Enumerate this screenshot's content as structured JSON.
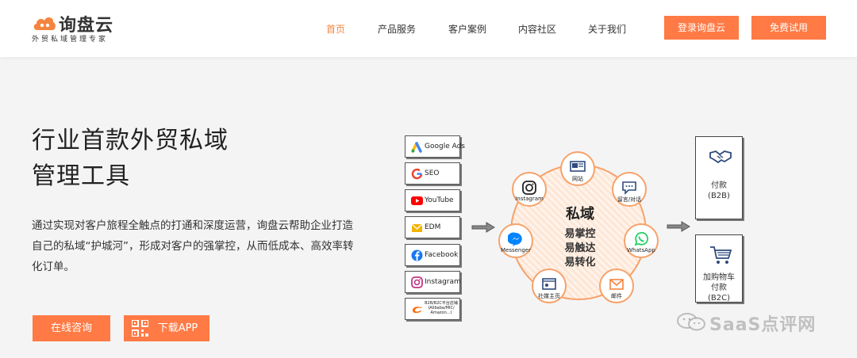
{
  "header": {
    "logo_name": "询盘云",
    "logo_tagline": "外贸私域管理专家",
    "nav": [
      "首页",
      "产品服务",
      "客户案例",
      "内容社区",
      "关于我们"
    ],
    "login_button": "登录询盘云",
    "trial_button": "免费试用"
  },
  "hero": {
    "title_line1": "行业首款外贸私域",
    "title_line2": "管理工具",
    "description": "通过实现对客户旅程全触点的打通和深度运营，询盘云帮助企业打造自己的私域“护城河”，形成对客户的强掌控，从而低成本、高效率转化订单。",
    "consult_button": "在线咨询",
    "download_button": "下载APP"
  },
  "diagram": {
    "sources": [
      {
        "label": "Google Ads",
        "icon": "google-ads-icon"
      },
      {
        "label": "SEO",
        "icon": "google-icon"
      },
      {
        "label": "YouTube",
        "icon": "youtube-icon"
      },
      {
        "label": "EDM",
        "icon": "edm-icon"
      },
      {
        "label": "Facebook",
        "icon": "facebook-icon"
      },
      {
        "label": "Instagram",
        "icon": "instagram-icon"
      },
      {
        "label": "B2B/B2C平台店铺 (Alibaba/MIC/ Amazon...)",
        "icon": "alibaba-icon"
      }
    ],
    "center_title": "私域",
    "center_lines": [
      "易掌控",
      "易触达",
      "易转化"
    ],
    "nodes": [
      "网站",
      "留言/对话",
      "WhatsApp",
      "邮件",
      "社媒主页",
      "Messenger",
      "Instagram"
    ],
    "destinations": [
      {
        "lines": [
          "付款",
          "(B2B)"
        ],
        "icon": "handshake-icon"
      },
      {
        "lines": [
          "加购物车",
          "付款",
          "(B2C)"
        ],
        "icon": "cart-icon"
      }
    ]
  },
  "watermark": "SaaS点评网",
  "colors": {
    "accent": "#ff7a45",
    "nav_active": "#f5843f",
    "ring": "#f6a26a"
  }
}
